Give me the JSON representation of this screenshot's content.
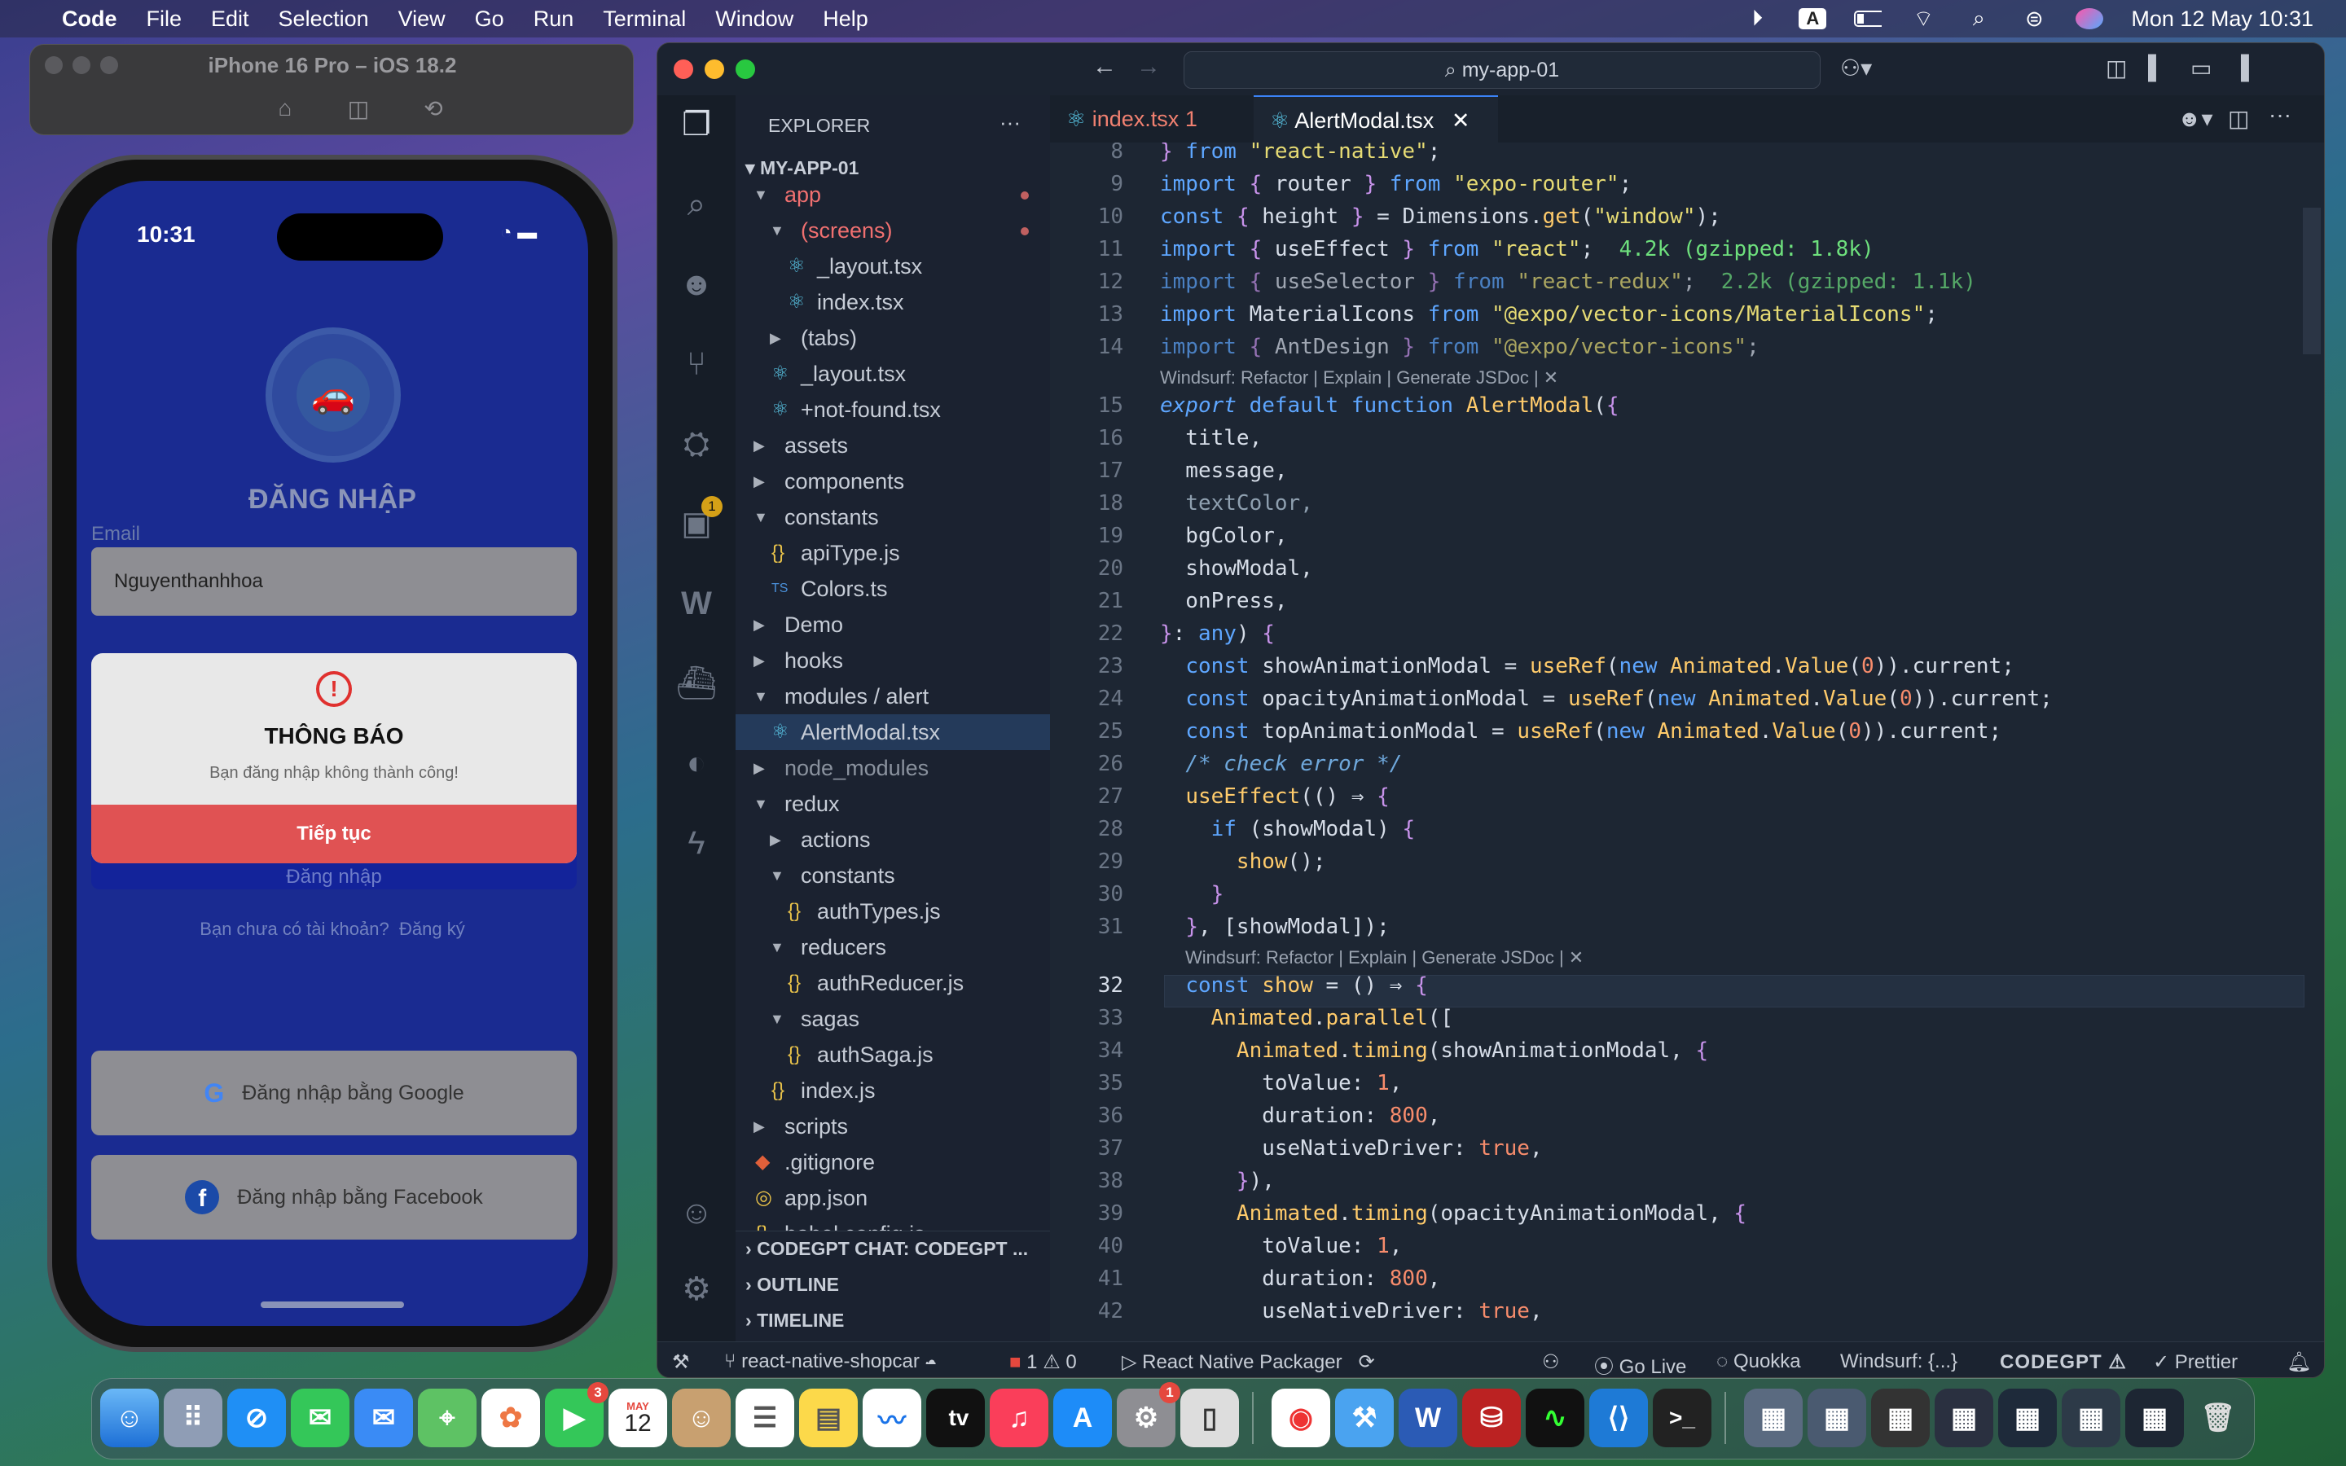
{
  "menubar": {
    "app": "Code",
    "items": [
      "File",
      "Edit",
      "Selection",
      "View",
      "Go",
      "Run",
      "Terminal",
      "Window",
      "Help"
    ],
    "clock": "Mon 12 May  10:31",
    "input_source": "A"
  },
  "simulator": {
    "title": "iPhone 16 Pro – iOS 18.2",
    "status_time": "10:31",
    "heading": "ĐĂNG NHẬP",
    "email_label": "Email",
    "email_value": "Nguyenthanhhoa",
    "dialog_title": "THÔNG BÁO",
    "dialog_message": "Bạn đăng nhập không thành công!",
    "dialog_button": "Tiếp tục",
    "login_button_hidden": "Đăng nhập",
    "signup_prompt": "Bạn chưa có tài khoản?",
    "signup_link": "Đăng ký",
    "google_button": "Đăng nhập bằng Google",
    "facebook_button": "Đăng nhập bằng Facebook"
  },
  "vscode": {
    "search": "my-app-01",
    "explorer_title": "EXPLORER",
    "explorer_more": "···",
    "project": "MY-APP-01",
    "tree": [
      {
        "label": "app",
        "indent": 0,
        "arrow": "▼",
        "icon": "",
        "color": "#f07070",
        "dot": true
      },
      {
        "label": "(screens)",
        "indent": 1,
        "arrow": "▼",
        "icon": "",
        "color": "#f07070",
        "dot": true
      },
      {
        "label": "_layout.tsx",
        "indent": 2,
        "arrow": "",
        "icon": "⚛",
        "color": "#c6ccd6"
      },
      {
        "label": "index.tsx",
        "indent": 2,
        "arrow": "",
        "icon": "⚛",
        "color": "#c6ccd6"
      },
      {
        "label": "(tabs)",
        "indent": 1,
        "arrow": "▶",
        "icon": "",
        "color": "#c6ccd6"
      },
      {
        "label": "_layout.tsx",
        "indent": 1,
        "arrow": "",
        "icon": "⚛",
        "color": "#c6ccd6"
      },
      {
        "label": "+not-found.tsx",
        "indent": 1,
        "arrow": "",
        "icon": "⚛",
        "color": "#c6ccd6"
      },
      {
        "label": "assets",
        "indent": 0,
        "arrow": "▶",
        "icon": "",
        "color": "#c6ccd6"
      },
      {
        "label": "components",
        "indent": 0,
        "arrow": "▶",
        "icon": "",
        "color": "#c6ccd6"
      },
      {
        "label": "constants",
        "indent": 0,
        "arrow": "▼",
        "icon": "",
        "color": "#c6ccd6"
      },
      {
        "label": "apiType.js",
        "indent": 1,
        "arrow": "",
        "icon": "{}",
        "color": "#c6ccd6"
      },
      {
        "label": "Colors.ts",
        "indent": 1,
        "arrow": "",
        "icon": "TS",
        "color": "#c6ccd6"
      },
      {
        "label": "Demo",
        "indent": 0,
        "arrow": "▶",
        "icon": "",
        "color": "#c6ccd6"
      },
      {
        "label": "hooks",
        "indent": 0,
        "arrow": "▶",
        "icon": "",
        "color": "#c6ccd6"
      },
      {
        "label": "modules / alert",
        "indent": 0,
        "arrow": "▼",
        "icon": "",
        "color": "#c6ccd6"
      },
      {
        "label": "AlertModal.tsx",
        "indent": 1,
        "arrow": "",
        "icon": "⚛",
        "color": "#c6ccd6",
        "selected": true
      },
      {
        "label": "node_modules",
        "indent": 0,
        "arrow": "▶",
        "icon": "",
        "color": "#8a929e"
      },
      {
        "label": "redux",
        "indent": 0,
        "arrow": "▼",
        "icon": "",
        "color": "#c6ccd6"
      },
      {
        "label": "actions",
        "indent": 1,
        "arrow": "▶",
        "icon": "",
        "color": "#c6ccd6"
      },
      {
        "label": "constants",
        "indent": 1,
        "arrow": "▼",
        "icon": "",
        "color": "#c6ccd6"
      },
      {
        "label": "authTypes.js",
        "indent": 2,
        "arrow": "",
        "icon": "{}",
        "color": "#c6ccd6"
      },
      {
        "label": "reducers",
        "indent": 1,
        "arrow": "▼",
        "icon": "",
        "color": "#c6ccd6"
      },
      {
        "label": "authReducer.js",
        "indent": 2,
        "arrow": "",
        "icon": "{}",
        "color": "#c6ccd6"
      },
      {
        "label": "sagas",
        "indent": 1,
        "arrow": "▼",
        "icon": "",
        "color": "#c6ccd6"
      },
      {
        "label": "authSaga.js",
        "indent": 2,
        "arrow": "",
        "icon": "{}",
        "color": "#c6ccd6"
      },
      {
        "label": "index.js",
        "indent": 1,
        "arrow": "",
        "icon": "{}",
        "color": "#c6ccd6"
      },
      {
        "label": "scripts",
        "indent": 0,
        "arrow": "▶",
        "icon": "",
        "color": "#c6ccd6"
      },
      {
        "label": ".gitignore",
        "indent": 0,
        "arrow": "",
        "icon": "◆",
        "color": "#c6ccd6"
      },
      {
        "label": "app.json",
        "indent": 0,
        "arrow": "",
        "icon": "◎",
        "color": "#c6ccd6"
      },
      {
        "label": "babel.config.js",
        "indent": 0,
        "arrow": "",
        "icon": "{}",
        "color": "#c6ccd6"
      }
    ],
    "panels": [
      "CODEGPT CHAT: CODEGPT ...",
      "OUTLINE",
      "TIMELINE"
    ],
    "tabs": [
      {
        "label": "index.tsx",
        "badge": "1",
        "active": false
      },
      {
        "label": "AlertModal.tsx",
        "badge": "",
        "active": true
      }
    ],
    "code_lens": "Windsurf: Refactor | Explain | Generate JSDoc | ✕",
    "status": {
      "branch": "react-native-shopcar",
      "errors": "1",
      "warnings": "0",
      "packager": "React Native Packager",
      "golive": "Go Live",
      "quokka": "Quokka",
      "windsurf": "Windsurf: {...}",
      "codegpt": "CODEGPT",
      "prettier": "Prettier"
    }
  },
  "dock": {
    "badges": {
      "facetime": "3",
      "settings": "1"
    },
    "calendar_month": "MAY",
    "calendar_day": "12",
    "tv_label": "tv"
  },
  "colors": {
    "vscode_bg": "#1d2633",
    "accent": "#3b82f6",
    "alert_red": "#e05253",
    "phone_bg": "#1a2b91"
  }
}
